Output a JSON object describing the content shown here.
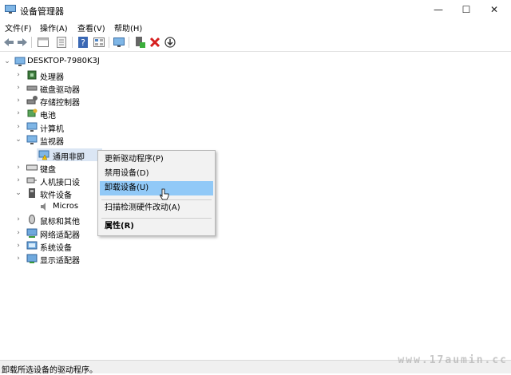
{
  "window": {
    "title": "设备管理器",
    "min": "—",
    "max": "☐",
    "close": "✕"
  },
  "menu": [
    "文件(F)",
    "操作(A)",
    "查看(V)",
    "帮助(H)"
  ],
  "toolbar": {
    "icons": [
      "back-icon",
      "forward-icon",
      "properties-view-icon",
      "show-hidden-icon",
      "help-icon",
      "grid-view-icon",
      "scan-monitor-icon",
      "update-driver-icon",
      "uninstall-icon",
      "disable-icon"
    ]
  },
  "tree": {
    "root": "DESKTOP-7980K3J",
    "items": [
      {
        "label": "处理器",
        "expanded": false,
        "icon": "cpu-icon"
      },
      {
        "label": "磁盘驱动器",
        "expanded": false,
        "icon": "disk-icon"
      },
      {
        "label": "存储控制器",
        "expanded": false,
        "icon": "storage-icon"
      },
      {
        "label": "电池",
        "expanded": false,
        "icon": "battery-icon"
      },
      {
        "label": "计算机",
        "expanded": false,
        "icon": "computer-icon"
      },
      {
        "label": "监视器",
        "expanded": true,
        "icon": "monitor-icon"
      },
      {
        "label": "通用非即",
        "child": true,
        "selected": true,
        "icon": "warning-monitor-icon"
      },
      {
        "label": "键盘",
        "expanded": false,
        "icon": "keyboard-icon"
      },
      {
        "label": "人机接口设",
        "expanded": false,
        "icon": "hid-icon"
      },
      {
        "label": "软件设备",
        "expanded": true,
        "icon": "software-device-icon"
      },
      {
        "label": "Micros",
        "child": true,
        "icon": "speaker-icon"
      },
      {
        "label": "鼠标和其他",
        "expanded": false,
        "icon": "mouse-icon"
      },
      {
        "label": "网络适配器",
        "expanded": false,
        "icon": "network-icon"
      },
      {
        "label": "系统设备",
        "expanded": false,
        "icon": "system-icon"
      },
      {
        "label": "显示适配器",
        "expanded": false,
        "icon": "display-adapter-icon"
      }
    ]
  },
  "context_menu": {
    "update": "更新驱动程序(P)",
    "disable": "禁用设备(D)",
    "uninstall": "卸载设备(U)",
    "scan": "扫描检测硬件改动(A)",
    "properties": "属性(R)"
  },
  "status": "卸载所选设备的驱动程序。",
  "watermark": "www.17aumin.cc",
  "colors": {
    "highlight": "#91c9f7",
    "selection": "#dbe6f4"
  }
}
